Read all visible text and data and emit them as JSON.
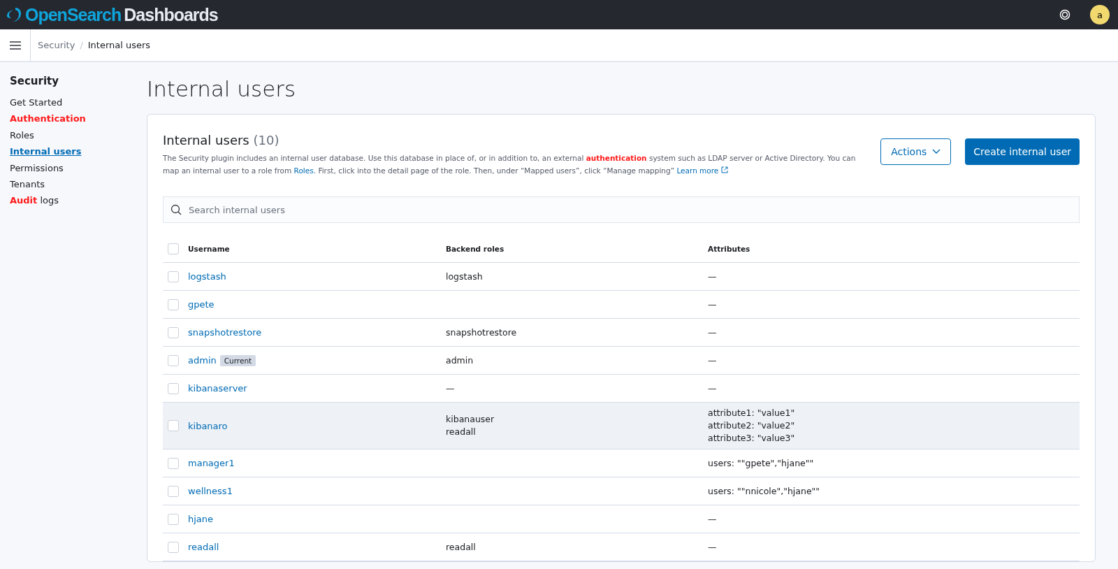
{
  "header": {
    "logo_parts": [
      "OpenSearch",
      "Dashboards"
    ],
    "avatar": "a"
  },
  "breadcrumb_separator": "/",
  "breadcrumbs": [
    {
      "label": "Security",
      "selected": false
    },
    {
      "label": "Internal users",
      "selected": true
    }
  ],
  "sidebar": {
    "title": "Security",
    "items": [
      {
        "parts": [
          {
            "text": "Get Started",
            "highlight": false
          }
        ],
        "selected": false
      },
      {
        "parts": [
          {
            "text": "Authentication",
            "highlight": true
          }
        ],
        "selected": false
      },
      {
        "parts": [
          {
            "text": "Roles",
            "highlight": false
          }
        ],
        "selected": false
      },
      {
        "parts": [
          {
            "text": "Internal users",
            "highlight": false
          }
        ],
        "selected": true
      },
      {
        "parts": [
          {
            "text": "Permissions",
            "highlight": false
          }
        ],
        "selected": false
      },
      {
        "parts": [
          {
            "text": "Tenants",
            "highlight": false
          }
        ],
        "selected": false
      },
      {
        "parts": [
          {
            "text": "Audit",
            "highlight": true
          },
          {
            "text": " logs",
            "highlight": false
          }
        ],
        "selected": false
      }
    ]
  },
  "page_title": "Internal users",
  "panel": {
    "title": "Internal users",
    "count": "(10)",
    "description": [
      {
        "kind": "text",
        "text": "The Security plugin includes an internal user database. Use this database in place of, or in addition to, an external "
      },
      {
        "kind": "highlight",
        "text": "authentication"
      },
      {
        "kind": "text",
        "text": " system such as LDAP server or Active Directory. You can map an internal user to a role from "
      },
      {
        "kind": "link",
        "text": "Roles."
      },
      {
        "kind": "text",
        "text": " First, click into the detail page of the role. Then, under “Mapped users”, click “Manage mapping” "
      },
      {
        "kind": "external_link",
        "text": "Learn more"
      }
    ],
    "actions_button": "Actions",
    "create_button": "Create internal user",
    "search": {
      "placeholder": "Search internal users"
    },
    "table": {
      "columns": [
        "Username",
        "Backend roles",
        "Attributes"
      ],
      "all_checked": false,
      "rows": [
        {
          "username": "logstash",
          "backend_roles": [
            "logstash"
          ],
          "attributes": [
            "—"
          ],
          "checked": false,
          "highlighted": false
        },
        {
          "username": "gpete",
          "attributes": [
            "—"
          ],
          "checked": false,
          "highlighted": false
        },
        {
          "username": "snapshotrestore",
          "backend_roles": [
            "snapshotrestore"
          ],
          "attributes": [
            "—"
          ],
          "checked": false,
          "highlighted": false
        },
        {
          "username": "admin",
          "badge": "Current",
          "backend_roles": [
            "admin"
          ],
          "attributes": [
            "—"
          ],
          "checked": false,
          "highlighted": false
        },
        {
          "username": "kibanaserver",
          "backend_roles": [
            "—"
          ],
          "attributes": [
            "—"
          ],
          "checked": false,
          "highlighted": false
        },
        {
          "username": "kibanaro",
          "backend_roles": [
            "kibanauser",
            "readall"
          ],
          "attributes": [
            "attribute1: \"value1\"",
            "attribute2: \"value2\"",
            "attribute3: \"value3\""
          ],
          "checked": false,
          "highlighted": true
        },
        {
          "username": "manager1",
          "attributes": [
            "users: \"\"gpete\",\"hjane\"\""
          ],
          "checked": false,
          "highlighted": false
        },
        {
          "username": "wellness1",
          "attributes": [
            "users: \"\"nnicole\",\"hjane\"\""
          ],
          "checked": false,
          "highlighted": false
        },
        {
          "username": "hjane",
          "attributes": [
            "—"
          ],
          "checked": false,
          "highlighted": false
        },
        {
          "username": "readall",
          "backend_roles": [
            "readall"
          ],
          "attributes": [
            "—"
          ],
          "checked": false,
          "highlighted": false
        }
      ]
    }
  }
}
